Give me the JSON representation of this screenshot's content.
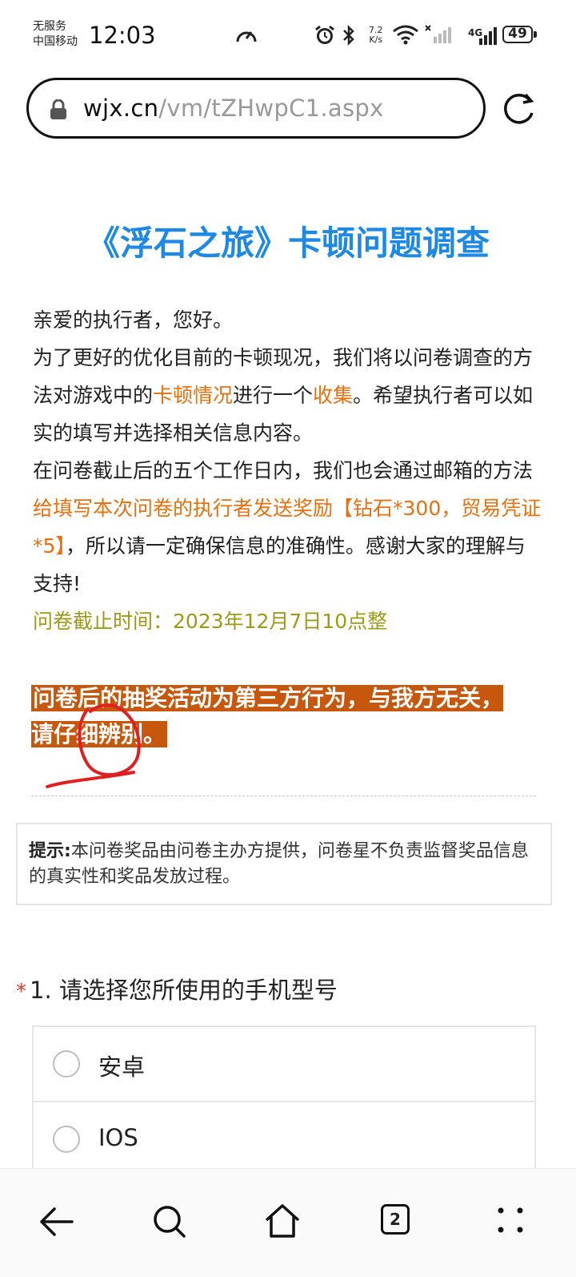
{
  "status_bar": {
    "carrier_line1": "无服务",
    "carrier_line2": "中国移动",
    "time": "12:03",
    "speed_value": "7.2",
    "speed_unit": "K/s",
    "network": "4G",
    "battery": "49"
  },
  "browser": {
    "url_domain": "wjx.cn",
    "url_path": "/vm/tZHwpC1.aspx"
  },
  "survey": {
    "title": "《浮石之旅》卡顿问题调查",
    "greeting": "亲爱的执行者，您好。",
    "p2_a": "为了更好的优化目前的卡顿现况，我们将以问卷调查的方法对游戏中的",
    "p2_hl1": "卡顿情况",
    "p2_b": "进行一个",
    "p2_hl2": "收集",
    "p2_c": "。希望执行者可以如实的填写并选择相关信息内容。",
    "p3_a": "在问卷截止后的五个工作日内，我们也会通过邮箱的方法",
    "p3_hl": "给填写本次问卷的执行者发送奖励【钻石*300，贸易凭证*5】",
    "p3_b": "，所以请一定确保信息的准确性。感谢大家的理解与支持!",
    "deadline": "问卷截止时间：2023年12月7日10点整",
    "warning": "问卷后的抽奖活动为第三方行为，与我方无关，请仔细辨别。"
  },
  "notice": {
    "label": "提示:",
    "text": "本问卷奖品由问卷主办方提供，问卷星不负责监督奖品信息的真实性和奖品发放过程。"
  },
  "question1": {
    "required_mark": "*",
    "title": "1. 请选择您所使用的手机型号",
    "options": [
      "安卓",
      "IOS"
    ]
  },
  "nav": {
    "tabs_count": "2"
  },
  "colors": {
    "title": "#1e88e5",
    "highlight": "#e8700f",
    "deadline": "#9c9a1a",
    "warning_bg": "#c8570e",
    "annotation": "#e02020"
  }
}
